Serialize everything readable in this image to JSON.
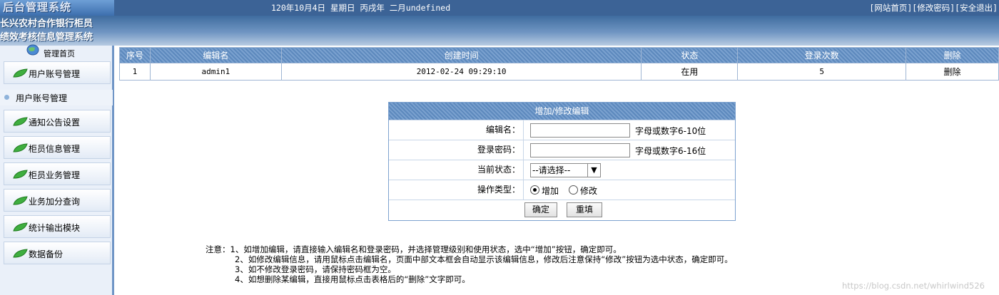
{
  "header": {
    "logo_text": "后台管理系统",
    "date_text": "120年10月4日 星期日 丙戌年 二月undefined",
    "links": [
      "[网站首页]",
      "[修改密码]",
      "[安全退出]"
    ],
    "system_name_line1": "长兴农村合作银行柜员",
    "system_name_line2": "绩效考核信息管理系统"
  },
  "sidebar": {
    "home_label": "管理首页",
    "items": [
      {
        "label": "用户账号管理",
        "icon": "leaf-icon"
      },
      {
        "label": "通知公告设置",
        "icon": "leaf-icon"
      },
      {
        "label": "柜员信息管理",
        "icon": "leaf-icon"
      },
      {
        "label": "柜员业务管理",
        "icon": "leaf-icon"
      },
      {
        "label": "业务加分查询",
        "icon": "leaf-icon"
      },
      {
        "label": "统计输出模块",
        "icon": "leaf-icon"
      },
      {
        "label": "数据备份",
        "icon": "leaf-icon"
      }
    ],
    "sub_item": "用户账号管理"
  },
  "table": {
    "columns": [
      "序号",
      "编辑名",
      "创建时间",
      "状态",
      "登录次数",
      "删除"
    ],
    "rows": [
      {
        "index": "1",
        "name": "admin1",
        "created": "2012-02-24 09:29:10",
        "status": "在用",
        "logins": "5",
        "delete": "删除"
      }
    ]
  },
  "form": {
    "title": "增加/修改编辑",
    "username_label": "编辑名：",
    "username_value": "",
    "username_hint": "字母或数字6-10位",
    "password_label": "登录密码：",
    "password_value": "",
    "password_hint": "字母或数字6-16位",
    "status_label": "当前状态：",
    "status_selected": "--请选择--",
    "optype_label": "操作类型：",
    "optype_options": [
      "增加",
      "修改"
    ],
    "optype_selected": "增加",
    "confirm_label": "确定",
    "reset_label": "重填"
  },
  "notes": {
    "lines": [
      "注意：1、如增加编辑，请直接输入编辑名和登录密码，并选择管理级别和使用状态，选中“增加”按钮，确定即可。",
      "2、如修改编辑信息，请用鼠标点击编辑名，页面中部文本框会自动显示该编辑信息，修改后注意保持“修改”按钮为选中状态，确定即可。",
      "3、如不修改登录密码，请保持密码框为空。",
      "4、如想删除某编辑，直接用鼠标点击表格后的“删除”文字即可。"
    ]
  },
  "watermark": "https://blog.csdn.net/whirlwind526",
  "colors": {
    "header_blue": "#3c6396",
    "table_header": "#6a94c6",
    "sidebar_bg": "#eaf0f9"
  }
}
